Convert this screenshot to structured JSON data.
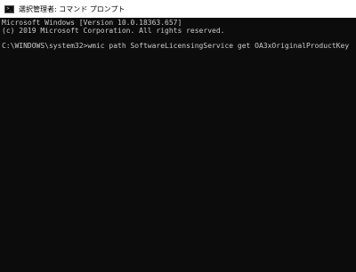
{
  "window": {
    "title": "選択管理者: コマンド プロンプト",
    "icon": "command-prompt-icon"
  },
  "console": {
    "lines": [
      "Microsoft Windows [Version 10.0.18363.657]",
      "(c) 2019 Microsoft Corporation. All rights reserved.",
      "",
      "C:\\WINDOWS\\system32>wmic path SoftwareLicensingService get OA3xOriginalProductKey"
    ]
  },
  "colors": {
    "background": "#0c0c0c",
    "text": "#cccccc",
    "titlebar": "#ffffff"
  }
}
